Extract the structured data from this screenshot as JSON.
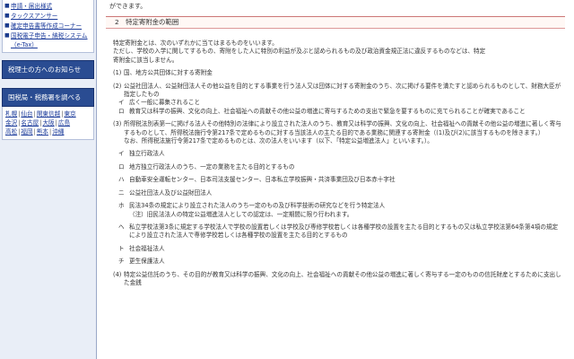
{
  "sidebar": {
    "top_links": [
      "申請・届出様式",
      "タックスアンサー",
      "確定申告書等作成コーナー",
      "国税電子申告・納税システム（e-Tax）"
    ],
    "link_bullet": "■",
    "tax_accountant_label": "税理士の方へのお知らせ",
    "tax_office_label": "国税局・税務署を調べる",
    "regions": [
      [
        "札幌",
        "仙台",
        "関東信越",
        "東京"
      ],
      [
        "金沢",
        "名古屋",
        "大阪",
        "広島"
      ],
      [
        "高松",
        "福岡",
        "熊本",
        "沖縄"
      ]
    ],
    "region_sep": "|"
  },
  "main": {
    "intro_text": "ができます。",
    "section_title": "2　特定寄附金の範囲",
    "paragraphs": [
      "特定寄附金とは、次のいずれかに当てはまるものをいいます。",
      "ただし、学校の入学に関してするもの、寄附をした人に特別の利益が及ぶと認められるもの及び政治資金規正法に違反するものなどは、特定",
      "寄附金に該当しません。"
    ],
    "items": [
      {
        "mk": "(1)",
        "text": "国、地方公共団体に対する寄附金"
      },
      {
        "mk": "(2)",
        "text": "公益社団法人、公益財団法人その他公益を目的とする事業を行う法人又は団体に対する寄附金のうち、次に掲げる要件を満たすと認められるものとして、財務大臣が指定したもの"
      }
    ],
    "sub_items_2": [
      {
        "mk": "イ",
        "text": "広く一般に募集されること"
      },
      {
        "mk": "ロ",
        "text": "教育又は科学の振興、文化の向上、社会福祉への貢献その他公益の増進に寄与するための支出で緊急を要するものに充てられることが確実であること"
      }
    ],
    "item3": {
      "mk": "(3)",
      "text": "所得税法別表第一に掲げる法人その他特別の法律により設立された法人のうち、教育又は科学の振興、文化の向上、社会福祉への貢献その他公益の増進に著しく寄与するものとして、所得税法施行令第217条で定めるものに対する当該法人の主たる目的である業務に関連する寄附金（(1)及び(2)に該当するものを除きます。）"
    },
    "item3_note": "なお、所得税法施行令第217条で定めるものとは、次の法人をいいます（以下、「特定公益増進法人」といいます。）。",
    "sub_items_3": [
      {
        "mk": "イ",
        "text": "独立行政法人"
      },
      {
        "mk": "ロ",
        "text": "地方独立行政法人のうち、一定の業務を主たる目的とするもの"
      },
      {
        "mk": "ハ",
        "text": "自動車安全運転センター、日本司法支援センター、日本私立学校振興・共済事業団及び日本赤十字社"
      },
      {
        "mk": "ニ",
        "text": "公益社団法人及び公益財団法人"
      },
      {
        "mk": "ホ",
        "text": "民法34条の規定により設立された法人のうち一定のもの及び科学技術の研究などを行う特定法人"
      },
      {
        "mk": "",
        "text": "（注）旧民法法人の特定公益増進法人としての認定は、一定期間に限り行われます。"
      },
      {
        "mk": "ヘ",
        "text": "私立学校法第3条に規定する学校法人で学校の設置若しくは学校及び専修学校若しくは各種学校の設置を主たる目的とするもの又は私立学校法第64条第4項の規定により設立された法人で専修学校若しくは各種学校の設置を主たる目的とするもの"
      },
      {
        "mk": "ト",
        "text": "社会福祉法人"
      },
      {
        "mk": "チ",
        "text": "更生保護法人"
      }
    ],
    "item4": {
      "mk": "(4)",
      "text": "特定公益信託のうち、その目的が教育又は科学の振興、文化の向上、社会福祉への貢献その他公益の増進に著しく寄与する一定のものの信託財産とするために支出した金銭"
    }
  }
}
